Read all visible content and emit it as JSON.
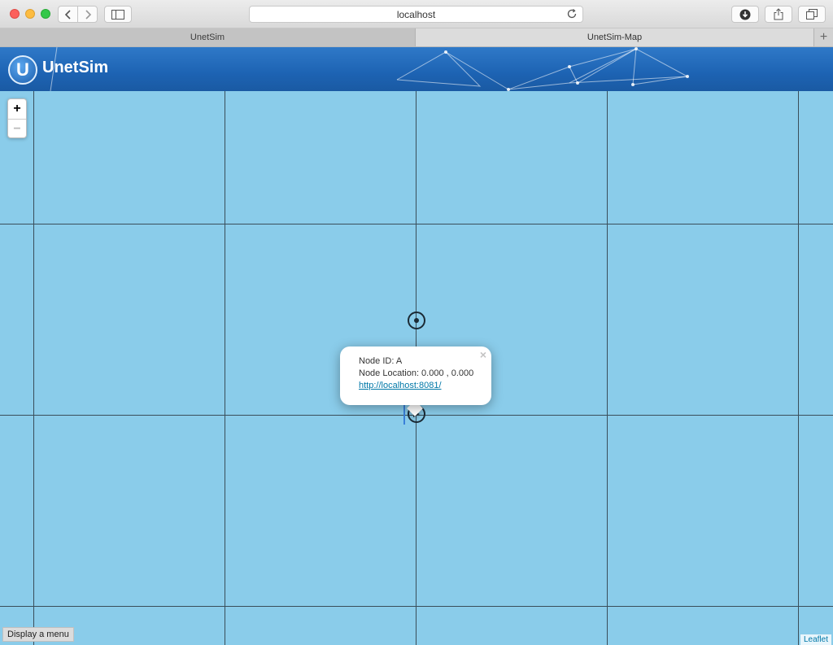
{
  "browser": {
    "url": "localhost",
    "tabs": [
      {
        "label": "UnetSim",
        "active": false
      },
      {
        "label": "UnetSim-Map",
        "active": true
      }
    ],
    "new_tab_label": "+"
  },
  "app": {
    "logo_letter": "U",
    "title": "UnetSim",
    "brand_color": "#1d63b3"
  },
  "map": {
    "background_color": "#8accea",
    "zoom_in_label": "+",
    "zoom_out_label": "−",
    "popup": {
      "node_id": "Node ID: A",
      "node_location": "Node Location: 0.000 , 0.000",
      "link": "http://localhost:8081/",
      "close_label": "×"
    },
    "menu_label": "Display a menu",
    "attribution": "Leaflet"
  }
}
